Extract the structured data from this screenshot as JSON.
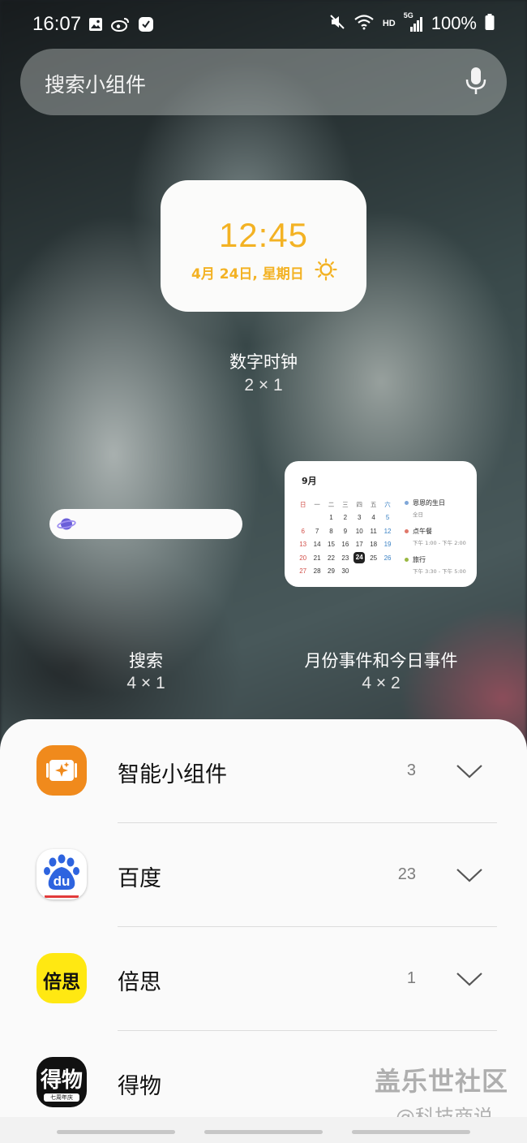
{
  "status_bar": {
    "time": "16:07",
    "battery": "100%",
    "network_hd": "HD",
    "network_5g": "5G",
    "icons_left": [
      "gallery-icon",
      "weibo-icon",
      "clock-check-icon"
    ],
    "icons_right": [
      "mute-icon",
      "wifi-icon",
      "signal-icon",
      "battery-icon"
    ]
  },
  "search": {
    "placeholder": "搜索小组件",
    "icon": "mic-icon"
  },
  "widgets": {
    "digital_clock": {
      "preview_time": "12:45",
      "preview_date": "4月 24日, 星期日",
      "label": "数字时钟",
      "size": "2 × 1",
      "accent": "#f3b223"
    },
    "search_widget": {
      "label": "搜索",
      "size": "4 × 1"
    },
    "calendar": {
      "label": "月份事件和今日事件",
      "size": "4 × 2",
      "month": "9月",
      "weekdays": [
        "日",
        "一",
        "二",
        "三",
        "四",
        "五",
        "六"
      ],
      "weeks": [
        [
          "",
          "",
          "1",
          "2",
          "3",
          "4",
          "5"
        ],
        [
          "6",
          "7",
          "8",
          "9",
          "10",
          "11",
          "12"
        ],
        [
          "13",
          "14",
          "15",
          "16",
          "17",
          "18",
          "19"
        ],
        [
          "20",
          "21",
          "22",
          "23",
          "24",
          "25",
          "26"
        ],
        [
          "27",
          "28",
          "29",
          "30",
          "",
          "",
          ""
        ]
      ],
      "today": "24",
      "events": [
        {
          "title": "恩恩的生日",
          "time": "全日",
          "color": "#7fa7d8"
        },
        {
          "title": "点午餐",
          "time": "下午 1:00 - 下午 2:00",
          "color": "#e0786a"
        },
        {
          "title": "旅行",
          "time": "下午 3:30 - 下午 5:00",
          "color": "#9ab843"
        }
      ]
    }
  },
  "app_list": [
    {
      "name": "智能小组件",
      "count": "3",
      "icon": "smart-widget-icon"
    },
    {
      "name": "百度",
      "count": "23",
      "icon": "baidu-icon",
      "icon_text": "du"
    },
    {
      "name": "倍思",
      "count": "1",
      "icon": "baseus-icon",
      "icon_text": "倍思"
    },
    {
      "name": "得物",
      "count": "",
      "icon": "dewu-icon",
      "icon_text": "得物",
      "icon_subtext": "七周年庆"
    }
  ],
  "watermark": {
    "line1": "盖乐世社区",
    "line2": "@科技商说"
  }
}
